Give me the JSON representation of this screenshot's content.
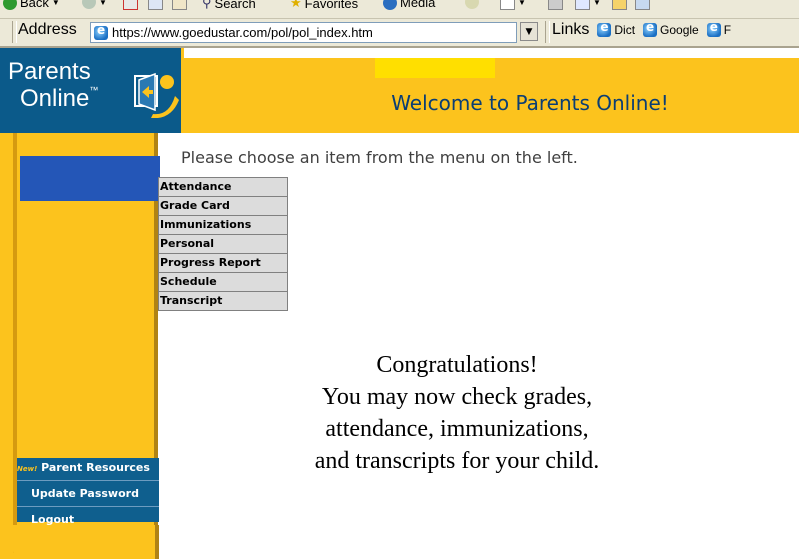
{
  "browser": {
    "toolbar": {
      "back_label": "Back",
      "search_label": "Search",
      "favorites_label": "Favorites",
      "media_label": "Media"
    },
    "address_label": "Address",
    "url": "https://www.goedustar.com/pol/pol_index.htm",
    "links_label": "Links",
    "links": [
      "Dict",
      "Google",
      "F"
    ]
  },
  "site": {
    "logo_line1": "Parents",
    "logo_line2": "Online",
    "logo_tm": "™",
    "welcome": "Welcome to Parents Online!",
    "instruction": "Please choose an item from the menu on the left.",
    "menu_items": [
      "Attendance",
      "Grade Card",
      "Immunizations",
      "Personal",
      "Progress Report",
      "Schedule",
      "Transcript"
    ],
    "sidebar": {
      "new_tag": "New!",
      "parent_resources": "Parent Resources",
      "update_password": "Update Password",
      "logout": "Logout"
    },
    "congrats": {
      "line1": "Congratulations!",
      "line2": "You may now check grades,",
      "line3": "attendance, immunizations,",
      "line4": "and transcripts for your child."
    }
  },
  "colors": {
    "header_yellow": "#fcc31d",
    "logo_blue": "#0b5a8a",
    "welcome_text": "#0b3e74",
    "sidebar_block": "#2456b7"
  }
}
